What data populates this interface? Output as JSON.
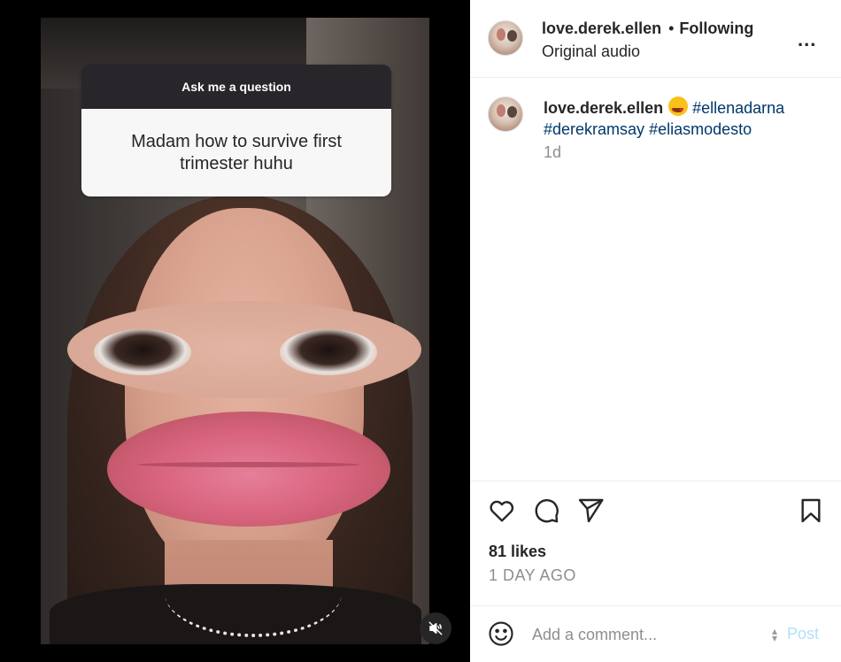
{
  "story": {
    "question_header": "Ask me a question",
    "question_text": "Madam how to survive first trimester huhu"
  },
  "header": {
    "username": "love.derek.ellen",
    "separator": "•",
    "follow_state": "Following",
    "audio": "Original audio",
    "more": "..."
  },
  "caption": {
    "username": "love.derek.ellen",
    "emoji": "star-struck-emoji",
    "hashtags": [
      "#ellenadarna",
      "#derekramsay",
      "#eliasmodesto"
    ],
    "time": "1d"
  },
  "actions": {
    "icons": [
      "heart-icon",
      "comment-icon",
      "share-icon",
      "bookmark-icon"
    ],
    "likes": "81 likes",
    "posted": "1 DAY AGO"
  },
  "comment": {
    "placeholder": "Add a comment...",
    "post_label": "Post"
  },
  "colors": {
    "link": "#00376b",
    "muted": "#8e8e8e",
    "post_disabled": "#b2dffc"
  }
}
